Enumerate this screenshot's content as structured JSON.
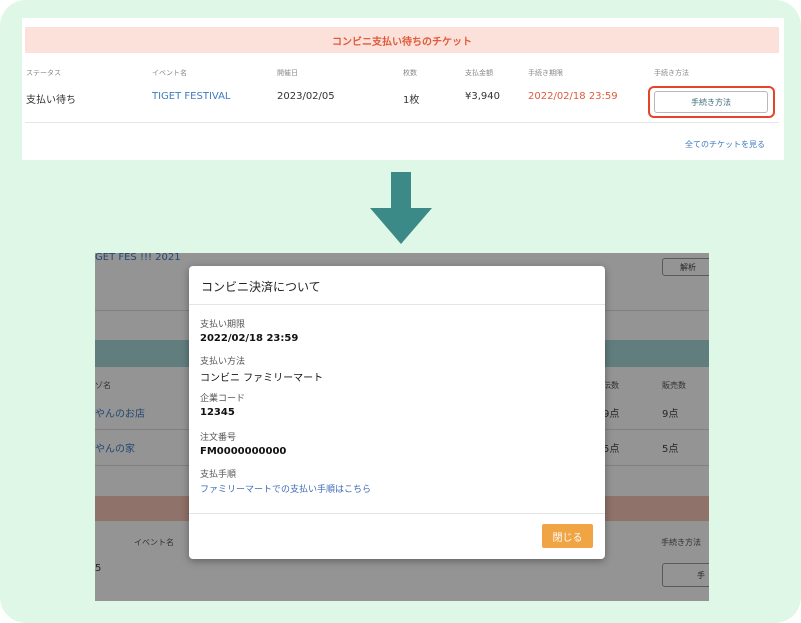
{
  "top": {
    "banner": "コンビニ支払い待ちのチケット",
    "columns": [
      "ステータス",
      "イベント名",
      "開催日",
      "枚数",
      "支払金額",
      "手続き期限",
      "手続き方法"
    ],
    "row": {
      "status": "支払い待ち",
      "event": "TIGET FESTIVAL",
      "date": "2023/02/05",
      "count": "1枚",
      "amount": "¥3,940",
      "deadline": "2022/02/18 23:59",
      "procedure_button": "手続き方法"
    },
    "all_tickets_link": "全てのチケットを見る"
  },
  "background": {
    "event_title": "GET FES !!! 2021",
    "analyze_button": "解析",
    "shop_col": "ゾ名",
    "shop1": "やんのお店",
    "shop2": "やんの家",
    "col_a": "伝数",
    "col_b": "販売数",
    "a1": "9点",
    "b1": "9点",
    "a2": "5点",
    "b2": "5点",
    "event_col": "イベント名",
    "proc_col": "手続き方法",
    "row_digit": "5",
    "proc_btn_fragment": "手"
  },
  "modal": {
    "title": "コンビニ決済について",
    "deadline_label": "支払い期限",
    "deadline_value": "2022/02/18 23:59",
    "method_label": "支払い方法",
    "method_value": "コンビニ ファミリーマート",
    "company_code_label": "企業コード",
    "company_code_value": "12345",
    "order_number_label": "注文番号",
    "order_number_value": "FM0000000000",
    "steps_label": "支払手順",
    "steps_link": "ファミリーマートでの支払い手順はこちら",
    "close_button": "閉じる"
  },
  "colors": {
    "frame_bg": "#dff7e6",
    "banner_bg": "#fbe1d9",
    "accent_red": "#e05a3c",
    "highlight_red": "#e2452c",
    "link_blue": "#3f7cc0",
    "arrow_teal": "#3b8a88",
    "close_orange": "#f0a444"
  },
  "icons": {
    "arrow": "arrow-down-icon"
  }
}
